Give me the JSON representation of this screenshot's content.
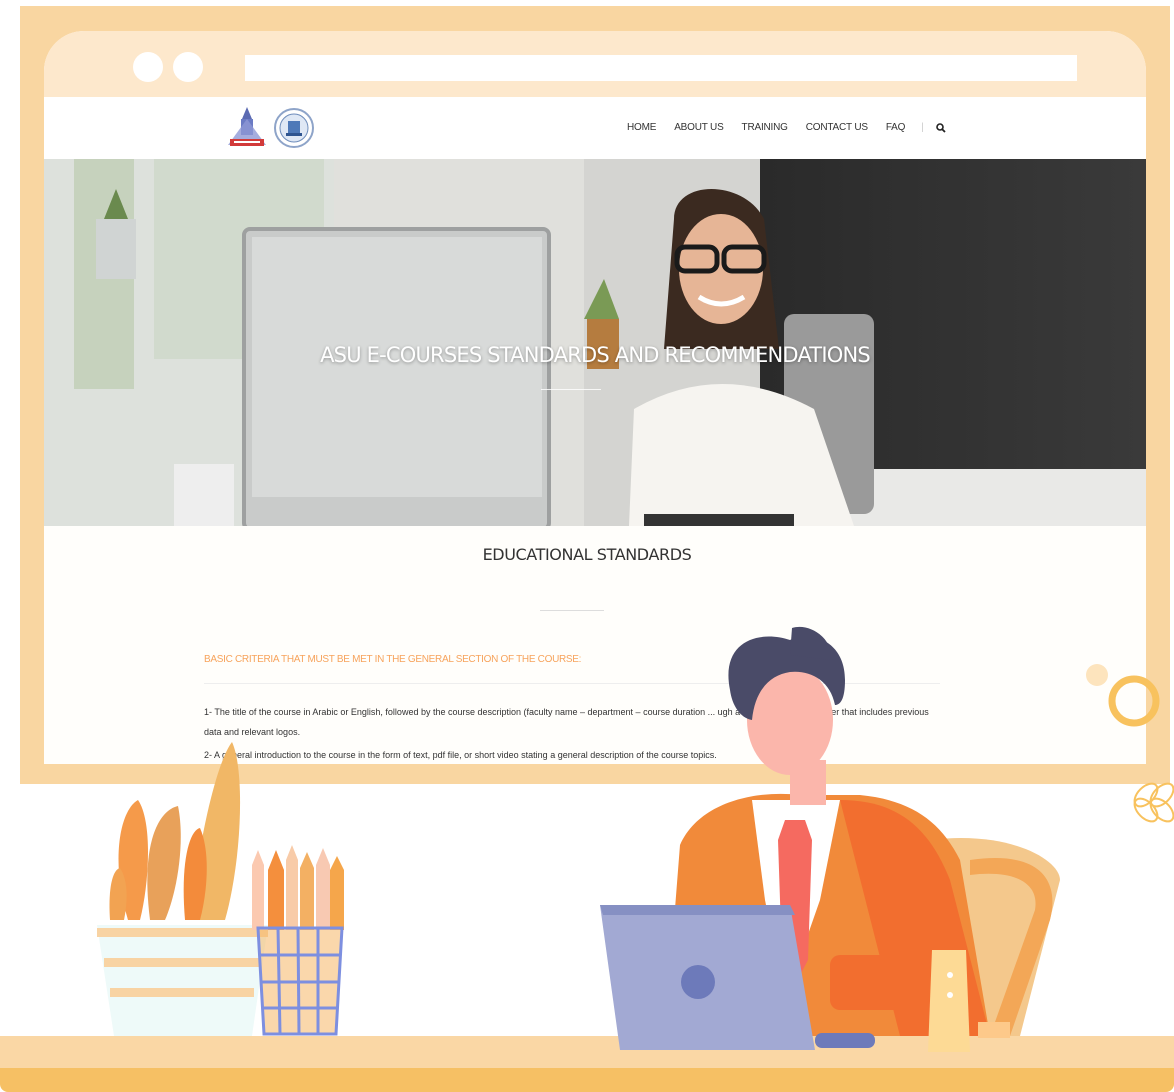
{
  "nav": {
    "items": [
      "HOME",
      "ABOUT US",
      "TRAINING",
      "CONTACT US",
      "FAQ"
    ],
    "separator": "|"
  },
  "hero": {
    "title": "ASU E-COURSES STANDARDS AND RECOMMENDATIONS"
  },
  "content": {
    "section_title": "EDUCATIONAL STANDARDS",
    "criteria_heading": "BASIC CRITERIA THAT MUST BE MET IN THE GENERAL SECTION OF THE COURSE:",
    "item1": "1- The title of the course in Arabic or English, followed by the course description (faculty name – department – course duration ... ugh a designed course banner that includes previous data and relevant logos.",
    "item2": "2- A general introduction to the course in the form of text, pdf file, or short video stating a general description of the course topics."
  },
  "colors": {
    "frame": "#f9d6a1",
    "titlebar": "#fde8cc",
    "accent_orange": "#f7a35c",
    "floor": "#f6c064"
  }
}
